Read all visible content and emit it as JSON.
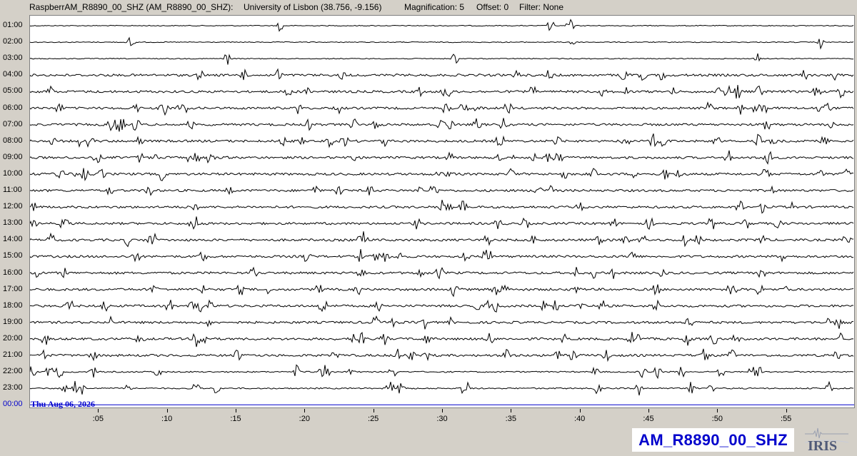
{
  "header": {
    "station": "RaspberrAM_R8890_00_SHZ (AM_R8890_00_SHZ):",
    "location": "University of Lisbon (38.756, -9.156)",
    "magnification": "Magnification: 5",
    "offset": "Offset: 0",
    "filter": "Filter: None"
  },
  "hours": [
    "01:00",
    "02:00",
    "03:00",
    "04:00",
    "05:00",
    "06:00",
    "07:00",
    "08:00",
    "09:00",
    "10:00",
    "11:00",
    "12:00",
    "13:00",
    "14:00",
    "15:00",
    "16:00",
    "17:00",
    "18:00",
    "19:00",
    "20:00",
    "21:00",
    "22:00",
    "23:00",
    "00:00"
  ],
  "date_label": "Thu Aug 06, 2026",
  "minute_axis": [
    ":05",
    ":10",
    ":15",
    ":20",
    ":25",
    ":30",
    ":35",
    ":40",
    ":45",
    ":50",
    ":55"
  ],
  "station_badge": "AM_R8890_00_SHZ",
  "logo": {
    "text": "IRIS",
    "icon": "iris-logo"
  },
  "colors": {
    "trace": "#000000",
    "current_line": "#0000cc",
    "label_accent": "#0000cc",
    "background": "#d4d0c8",
    "plot_bg": "#ffffff"
  }
}
